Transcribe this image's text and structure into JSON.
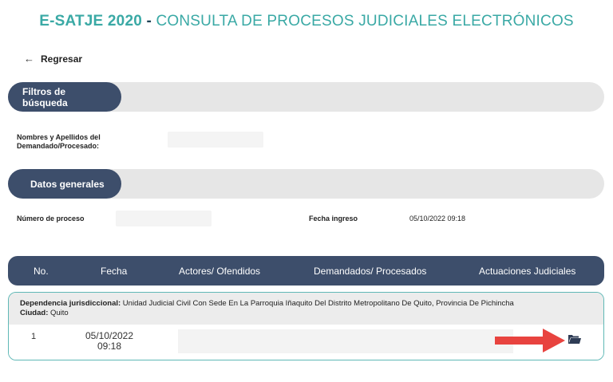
{
  "header": {
    "brand": "E-SATJE 2020",
    "separator": " - ",
    "subtitle": "CONSULTA DE PROCESOS JUDICIALES ELECTRÓNICOS"
  },
  "nav": {
    "back_icon": "arrow-left-icon",
    "back_label": "Regresar"
  },
  "filters": {
    "section_label": "Filtros de búsqueda",
    "name_label_line1": "Nombres y Apellidos del",
    "name_label_line2": "Demandado/Procesado:",
    "name_value": ""
  },
  "general": {
    "section_label": "Datos generales",
    "process_number_label": "Número de proceso",
    "process_number_value": "",
    "entry_date_label": "Fecha ingreso",
    "entry_date_value": "05/10/2022 09:18"
  },
  "table": {
    "columns": [
      "No.",
      "Fecha",
      "Actores/ Ofendidos",
      "Demandados/ Procesados",
      "Actuaciones Judiciales"
    ],
    "groups": [
      {
        "dependency_label": "Dependencia jurisdiccional:",
        "dependency_value": " Unidad Judicial Civil Con Sede En La Parroquia Iñaquito Del Distrito Metropolitano De Quito, Provincia De Pichincha",
        "city_label": "Ciudad:",
        "city_value": " Quito",
        "rows": [
          {
            "no": "1",
            "date_line1": "05/10/2022",
            "date_line2": "09:18",
            "action_icon": "folder-open-icon"
          }
        ]
      }
    ]
  },
  "colors": {
    "accent_teal": "#3aa9a5",
    "nav_dark": "#3d4e6b",
    "bar_gray": "#e6e6e6",
    "arrow_red": "#e8433f"
  }
}
